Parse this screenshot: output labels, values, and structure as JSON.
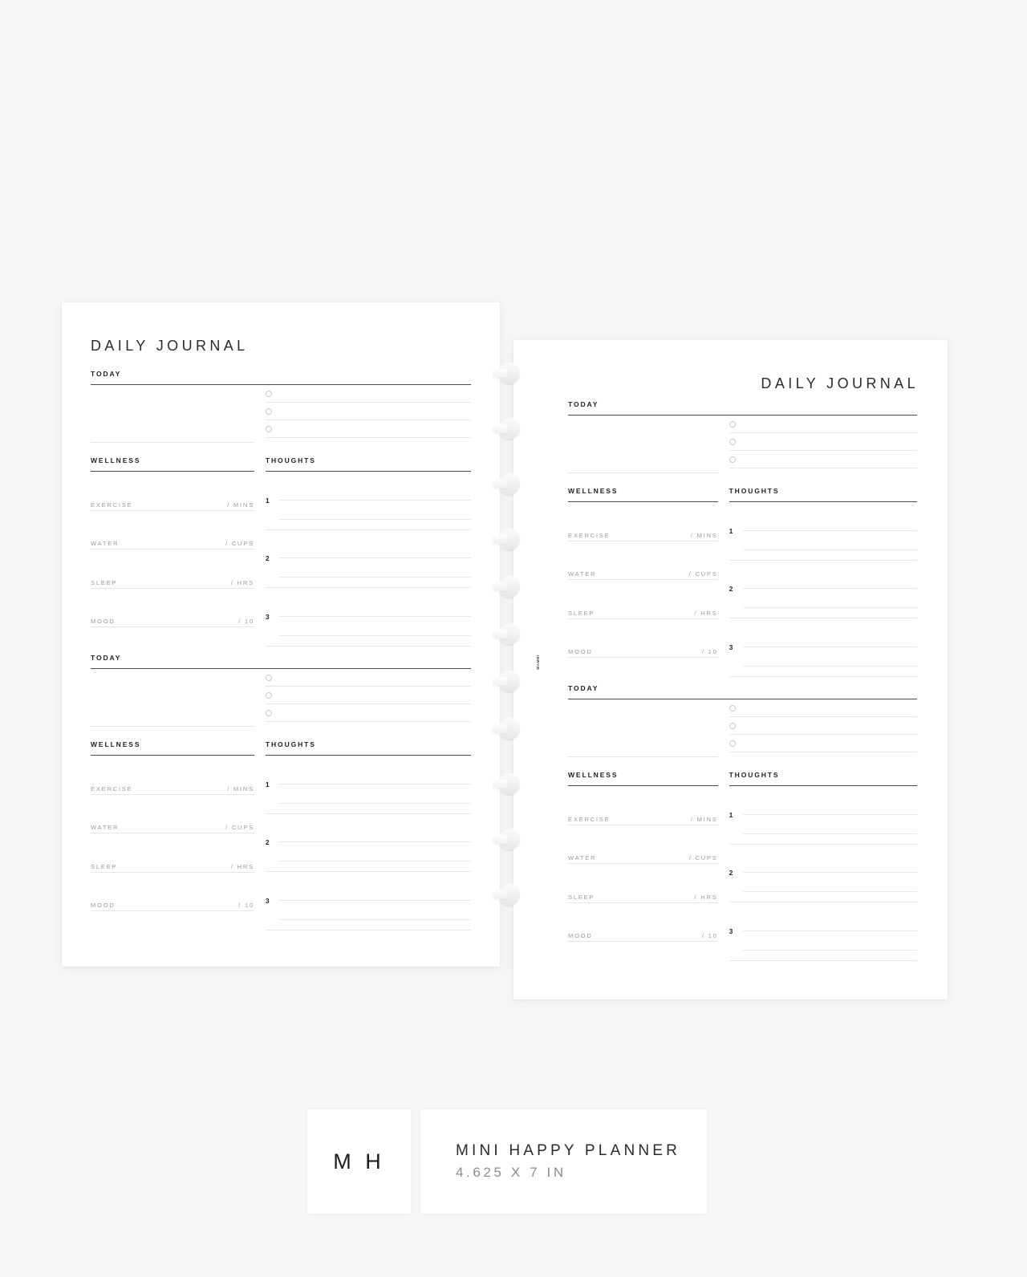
{
  "background_color": "#f7f7f7",
  "sheet_color": "#ffffff",
  "accent_colors": {
    "heading_text": "#1f1f1f",
    "label_text": "#9a9a9a",
    "rule_dark": "#4a4a4a",
    "rule_light": "#e6e6e6",
    "footer_subtext": "#8d8d8d"
  },
  "pages": {
    "left": {
      "title": "DAILY JOURNAL",
      "title_align": "left",
      "watermark": "MAMBI",
      "blocks": [
        {
          "today_heading": "TODAY",
          "checklist": [
            {
              "icon": "circle-checkbox",
              "text": ""
            },
            {
              "icon": "circle-checkbox",
              "text": ""
            },
            {
              "icon": "circle-checkbox",
              "text": ""
            }
          ],
          "wellness_heading": "WELLNESS",
          "wellness_rows": [
            {
              "label": "EXERCISE",
              "unit": "/ MINS",
              "value": ""
            },
            {
              "label": "WATER",
              "unit": "/ CUPS",
              "value": ""
            },
            {
              "label": "SLEEP",
              "unit": "/ HRS",
              "value": ""
            },
            {
              "label": "MOOD",
              "unit": "/ 10",
              "value": ""
            }
          ],
          "thoughts_heading": "THOUGHTS",
          "thoughts": [
            {
              "number": "1",
              "text": ""
            },
            {
              "number": "2",
              "text": ""
            },
            {
              "number": "3",
              "text": ""
            }
          ]
        },
        {
          "today_heading": "TODAY",
          "checklist": [
            {
              "icon": "circle-checkbox",
              "text": ""
            },
            {
              "icon": "circle-checkbox",
              "text": ""
            },
            {
              "icon": "circle-checkbox",
              "text": ""
            }
          ],
          "wellness_heading": "WELLNESS",
          "wellness_rows": [
            {
              "label": "EXERCISE",
              "unit": "/ MINS",
              "value": ""
            },
            {
              "label": "WATER",
              "unit": "/ CUPS",
              "value": ""
            },
            {
              "label": "SLEEP",
              "unit": "/ HRS",
              "value": ""
            },
            {
              "label": "MOOD",
              "unit": "/ 10",
              "value": ""
            }
          ],
          "thoughts_heading": "THOUGHTS",
          "thoughts": [
            {
              "number": "1",
              "text": ""
            },
            {
              "number": "2",
              "text": ""
            },
            {
              "number": "3",
              "text": ""
            }
          ]
        }
      ]
    },
    "right": {
      "title": "DAILY JOURNAL",
      "title_align": "right",
      "watermark": "MAMBI",
      "blocks": [
        {
          "today_heading": "TODAY",
          "checklist": [
            {
              "icon": "circle-checkbox",
              "text": ""
            },
            {
              "icon": "circle-checkbox",
              "text": ""
            },
            {
              "icon": "circle-checkbox",
              "text": ""
            }
          ],
          "wellness_heading": "WELLNESS",
          "wellness_rows": [
            {
              "label": "EXERCISE",
              "unit": "/ MINS",
              "value": ""
            },
            {
              "label": "WATER",
              "unit": "/ CUPS",
              "value": ""
            },
            {
              "label": "SLEEP",
              "unit": "/ HRS",
              "value": ""
            },
            {
              "label": "MOOD",
              "unit": "/ 10",
              "value": ""
            }
          ],
          "thoughts_heading": "THOUGHTS",
          "thoughts": [
            {
              "number": "1",
              "text": ""
            },
            {
              "number": "2",
              "text": ""
            },
            {
              "number": "3",
              "text": ""
            }
          ]
        },
        {
          "today_heading": "TODAY",
          "checklist": [
            {
              "icon": "circle-checkbox",
              "text": ""
            },
            {
              "icon": "circle-checkbox",
              "text": ""
            },
            {
              "icon": "circle-checkbox",
              "text": ""
            }
          ],
          "wellness_heading": "WELLNESS",
          "wellness_rows": [
            {
              "label": "EXERCISE",
              "unit": "/ MINS",
              "value": ""
            },
            {
              "label": "WATER",
              "unit": "/ CUPS",
              "value": ""
            },
            {
              "label": "SLEEP",
              "unit": "/ HRS",
              "value": ""
            },
            {
              "label": "MOOD",
              "unit": "/ 10",
              "value": ""
            }
          ],
          "thoughts_heading": "THOUGHTS",
          "thoughts": [
            {
              "number": "1",
              "text": ""
            },
            {
              "number": "2",
              "text": ""
            },
            {
              "number": "3",
              "text": ""
            }
          ]
        }
      ]
    }
  },
  "binding": {
    "icon": "disc-binding-ring",
    "disc_count_left": 11,
    "disc_count_right": 11
  },
  "footer": {
    "logo": "M H",
    "product_name": "MINI HAPPY PLANNER",
    "size": "4.625 X 7 IN"
  }
}
